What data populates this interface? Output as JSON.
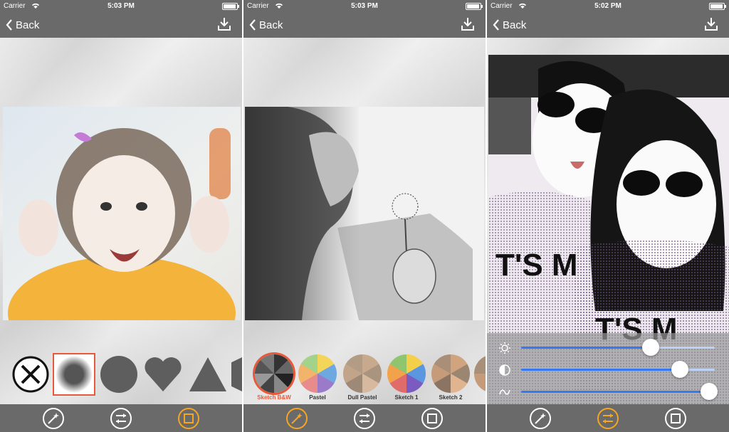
{
  "screens": [
    {
      "status": {
        "carrier": "Carrier",
        "time": "5:03 PM"
      },
      "nav": {
        "back_label": "Back"
      }
    },
    {
      "status": {
        "carrier": "Carrier",
        "time": "5:03 PM"
      },
      "nav": {
        "back_label": "Back"
      },
      "filters": [
        {
          "label": "Sketch B&W",
          "selected": true
        },
        {
          "label": "Pastel",
          "selected": false
        },
        {
          "label": "Dull Pastel",
          "selected": false
        },
        {
          "label": "Sketch 1",
          "selected": false
        },
        {
          "label": "Sketch 2",
          "selected": false
        }
      ]
    },
    {
      "status": {
        "carrier": "Carrier",
        "time": "5:02 PM"
      },
      "nav": {
        "back_label": "Back"
      },
      "sliders": [
        {
          "icon": "brightness-icon",
          "value": 0.67
        },
        {
          "icon": "contrast-icon",
          "value": 0.82
        },
        {
          "icon": "wave-icon",
          "value": 0.97
        }
      ]
    }
  ],
  "shapes": [
    "no-mask-icon",
    "blur-circle-icon",
    "circle-icon",
    "heart-icon",
    "triangle-icon"
  ],
  "colors": {
    "bar": "#6a6a6a",
    "accent": "#f5a623",
    "selection": "#e65a3b",
    "slider": "#3478f6"
  }
}
